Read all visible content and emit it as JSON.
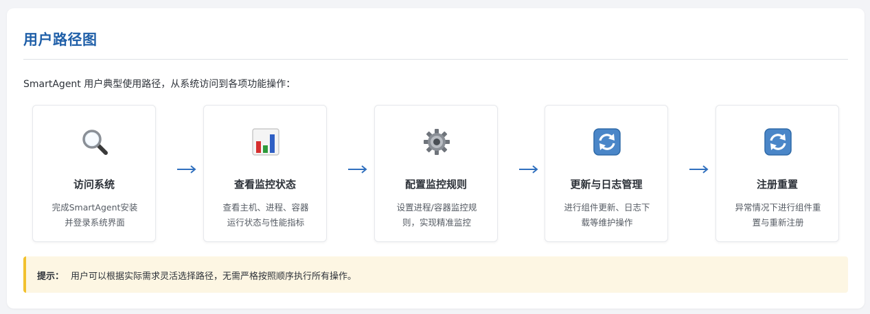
{
  "header": {
    "title": "用户路径图"
  },
  "intro": "SmartAgent 用户典型使用路径，从系统访问到各项功能操作：",
  "steps": [
    {
      "icon": "magnifier-icon",
      "title": "访问系统",
      "desc_lines": [
        "完成SmartAgent安装",
        "并登录系统界面"
      ]
    },
    {
      "icon": "bar-chart-icon",
      "title": "查看监控状态",
      "desc_lines": [
        "查看主机、进程、容器",
        "运行状态与性能指标"
      ]
    },
    {
      "icon": "gear-icon",
      "title": "配置监控规则",
      "desc_lines": [
        "设置进程/容器监控规",
        "则，实现精准监控"
      ]
    },
    {
      "icon": "refresh-icon",
      "title": "更新与日志管理",
      "desc_lines": [
        "进行组件更新、日志下",
        "载等维护操作"
      ]
    },
    {
      "icon": "refresh-icon",
      "title": "注册重置",
      "desc_lines": [
        "异常情况下进行组件重",
        "置与重新注册"
      ]
    }
  ],
  "arrow_symbol": "→",
  "tip": {
    "label": "提示：",
    "text": "用户可以根据实际需求灵活选择路径，无需严格按照顺序执行所有操作。"
  },
  "colors": {
    "title": "#1f5fa8",
    "arrow": "#2f6fbe",
    "tip_bg": "#fdf6e3",
    "tip_border": "#f2c12e"
  }
}
